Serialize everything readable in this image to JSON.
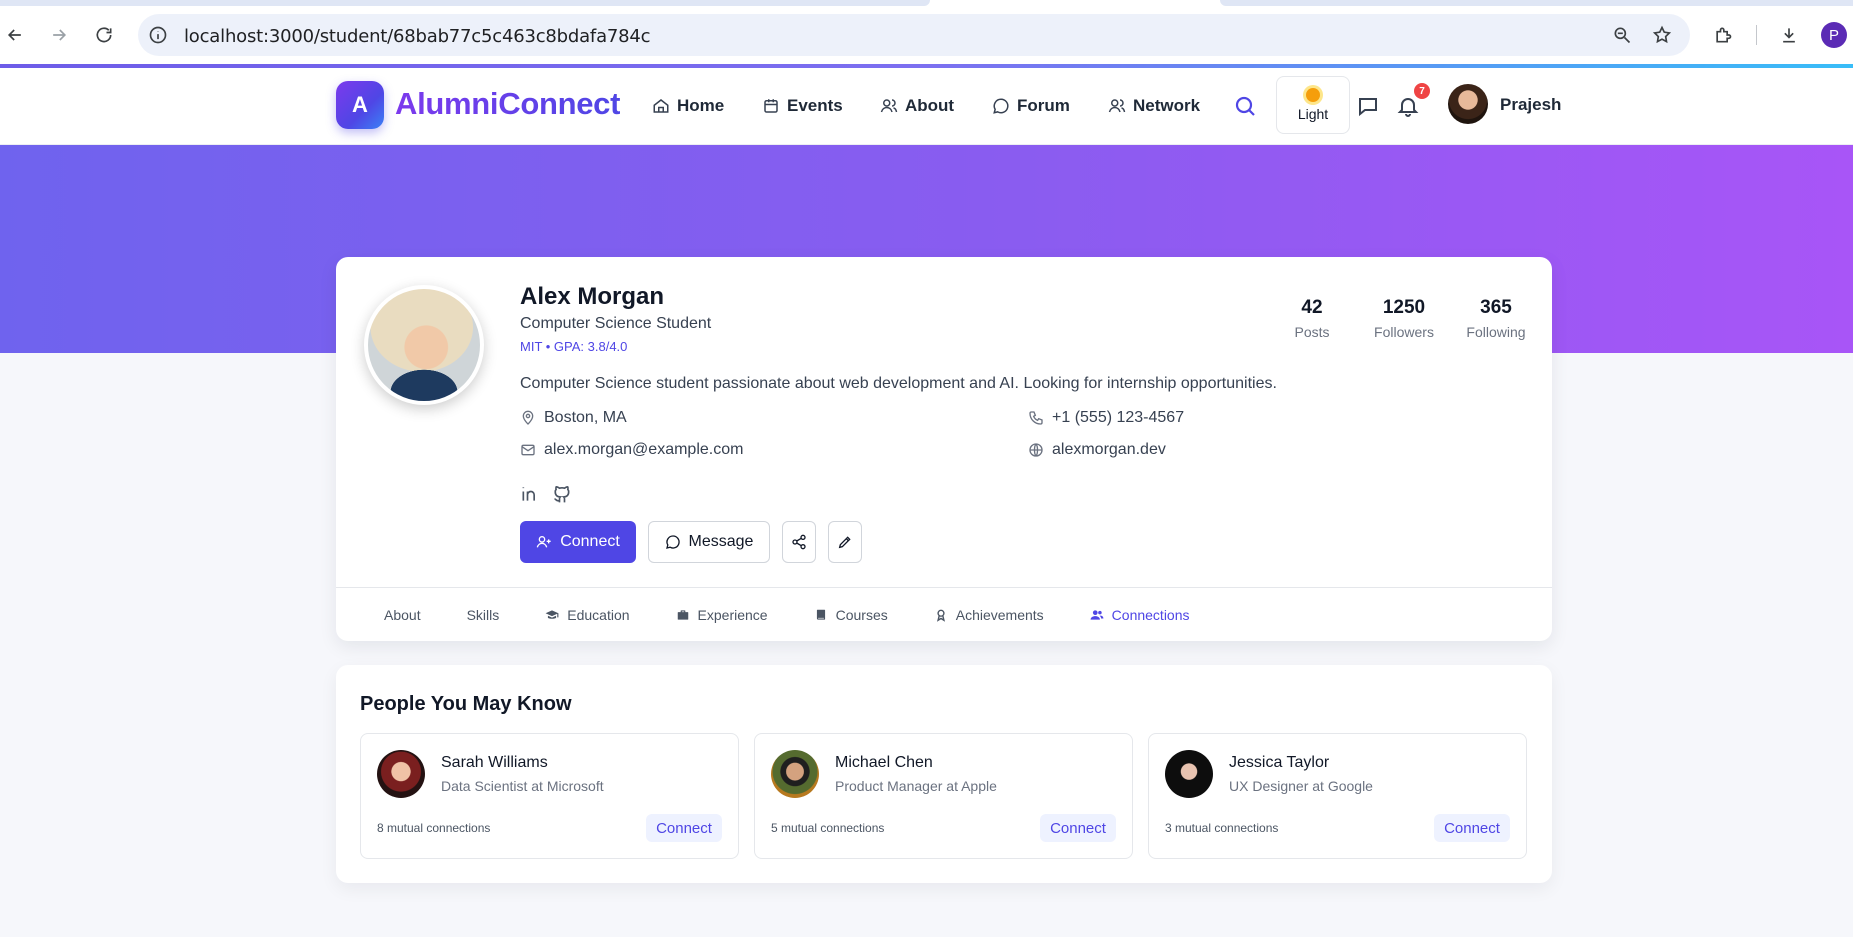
{
  "browser": {
    "url": "localhost:3000/student/68bab77c5c463c8bdafa784c",
    "profile_initial": "P"
  },
  "header": {
    "logo_letter": "A",
    "brand": "AlumniConnect",
    "nav": [
      {
        "label": "Home",
        "icon": "home-icon"
      },
      {
        "label": "Events",
        "icon": "calendar-icon"
      },
      {
        "label": "About",
        "icon": "users-icon"
      },
      {
        "label": "Forum",
        "icon": "chat-bubble-icon"
      },
      {
        "label": "Network",
        "icon": "users-icon"
      }
    ],
    "theme_label": "Light",
    "notification_count": "7",
    "user_name": "Prajesh"
  },
  "profile": {
    "name": "Alex Morgan",
    "title": "Computer Science Student",
    "school_line": "MIT • GPA: 3.8/4.0",
    "bio": "Computer Science student passionate about web development and AI. Looking for internship opportunities.",
    "stats": [
      {
        "value": "42",
        "label": "Posts"
      },
      {
        "value": "1250",
        "label": "Followers"
      },
      {
        "value": "365",
        "label": "Following"
      }
    ],
    "location": "Boston, MA",
    "phone": "+1 (555) 123-4567",
    "email": "alex.morgan@example.com",
    "website": "alexmorgan.dev",
    "social": [
      "linkedin-icon",
      "github-icon"
    ],
    "actions": {
      "connect": "Connect",
      "message": "Message"
    }
  },
  "tabs": [
    {
      "label": "About",
      "icon": null,
      "active": false
    },
    {
      "label": "Skills",
      "icon": null,
      "active": false
    },
    {
      "label": "Education",
      "icon": "graduation-cap-icon",
      "active": false
    },
    {
      "label": "Experience",
      "icon": "briefcase-icon",
      "active": false
    },
    {
      "label": "Courses",
      "icon": "book-icon",
      "active": false
    },
    {
      "label": "Achievements",
      "icon": "award-icon",
      "active": false
    },
    {
      "label": "Connections",
      "icon": "users-icon",
      "active": true
    }
  ],
  "people_you_may_know": {
    "title": "People You May Know",
    "people": [
      {
        "name": "Sarah Williams",
        "role": "Data Scientist at Microsoft",
        "mutual": "8 mutual connections",
        "action": "Connect"
      },
      {
        "name": "Michael Chen",
        "role": "Product Manager at Apple",
        "mutual": "5 mutual connections",
        "action": "Connect"
      },
      {
        "name": "Jessica Taylor",
        "role": "UX Designer at Google",
        "mutual": "3 mutual connections",
        "action": "Connect"
      }
    ]
  },
  "colors": {
    "accent": "#4f46e5",
    "brand_purple": "#7c3aed",
    "banner_start": "#6f63ee",
    "banner_end": "#a855f7",
    "notification": "#ef4444"
  }
}
